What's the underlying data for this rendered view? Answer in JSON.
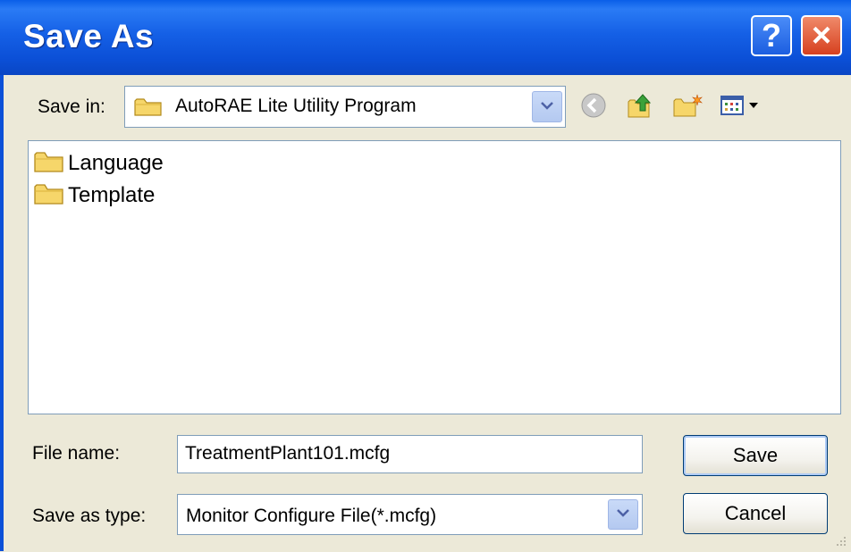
{
  "window": {
    "title": "Save As",
    "help_label": "?",
    "close_label": "×"
  },
  "save_in": {
    "label": "Save in:",
    "value": "AutoRAE Lite Utility Program"
  },
  "toolbar": {
    "icons": [
      "back-icon",
      "up-folder-icon",
      "new-folder-icon",
      "views-menu-icon"
    ]
  },
  "files": [
    {
      "name": "Language",
      "icon": "folder-icon"
    },
    {
      "name": "Template",
      "icon": "folder-icon"
    }
  ],
  "file_name": {
    "label": "File name:",
    "value": "TreatmentPlant101.mcfg"
  },
  "save_as_type": {
    "label": "Save as type:",
    "value": "Monitor Configure File(*.mcfg)"
  },
  "buttons": {
    "save": "Save",
    "cancel": "Cancel"
  },
  "colors": {
    "titlebar": "#0a5fe8",
    "dialog_bg": "#ece9d8",
    "close_button": "#d6401f"
  }
}
